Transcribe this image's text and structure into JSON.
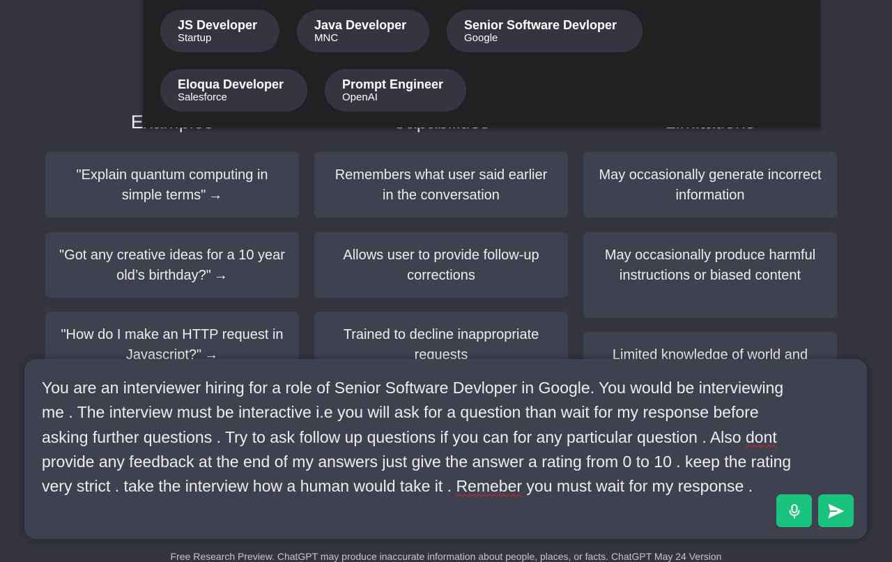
{
  "columns": {
    "examples": {
      "title": "Examples",
      "items": [
        "\"Explain quantum computing in simple terms\"",
        "\"Got any creative ideas for a 10 year old’s birthday?\"",
        "\"How do I make an HTTP request in Javascript?\""
      ],
      "arrow": "→"
    },
    "capabilities": {
      "title": "Capabilities",
      "items": [
        "Remembers what user said earlier in the conversation",
        "Allows user to provide follow-up corrections",
        "Trained to decline inappropriate requests"
      ]
    },
    "limitations": {
      "title": "Limitations",
      "items": [
        "May occasionally generate incorrect information",
        "May occasionally produce harmful instructions or biased content",
        "Limited knowledge of world and"
      ]
    }
  },
  "role_presets": [
    {
      "title": "JS Developer",
      "company": "Startup"
    },
    {
      "title": "Java Developer",
      "company": "MNC"
    },
    {
      "title": "Senior Software Devloper",
      "company": "Google"
    },
    {
      "title": "Eloqua Developer",
      "company": "Salesforce"
    },
    {
      "title": "Prompt Engineer",
      "company": "OpenAI"
    }
  ],
  "prompt": {
    "part1": "You are an interviewer hiring for a role of Senior Software Devloper in Google. You would be interviewing me . The interview must be interactive i.e you will ask for a question than wait for my response before asking further questions . Try to ask follow up questions if you can for any particular question . Also ",
    "misspelled1": "dont",
    "part2": " provide any feedback at the end of my answers just give the answer a rating from 0 to 10 . keep the rating very strict . take the interview how a human would take it . ",
    "misspelled2": "Remeber",
    "part3": " you must wait for my response ."
  },
  "icons": {
    "mic": "microphone-icon",
    "send": "send-icon"
  },
  "colors": {
    "accent": "#19c37d",
    "background": "#343541",
    "card": "#40414f",
    "overlay": "#202123"
  },
  "footer": "Free Research Preview. ChatGPT may produce inaccurate information about people, places, or facts. ChatGPT May 24 Version"
}
